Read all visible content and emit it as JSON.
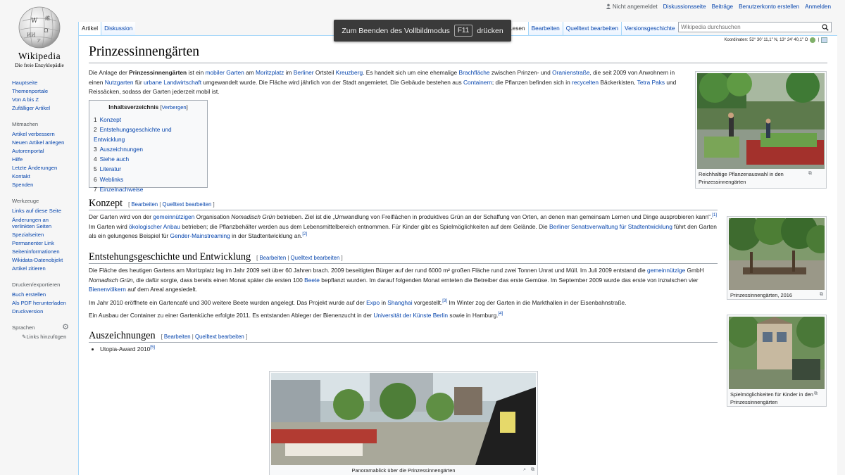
{
  "personal": {
    "notloggedin": "Nicht angemeldet",
    "links": [
      "Diskussionsseite",
      "Beiträge",
      "Benutzerkonto erstellen",
      "Anmelden"
    ]
  },
  "logo": {
    "wordmark": "Wikipedia",
    "tagline": "Die freie Enzyklopädie"
  },
  "sidebar": {
    "nav": [
      "Hauptseite",
      "Themenportale",
      "Von A bis Z",
      "Zufälliger Artikel"
    ],
    "mitmachen_title": "Mitmachen",
    "mitmachen": [
      "Artikel verbessern",
      "Neuen Artikel anlegen",
      "Autorenportal",
      "Hilfe",
      "Letzte Änderungen",
      "Kontakt",
      "Spenden"
    ],
    "werkzeuge_title": "Werkzeuge",
    "werkzeuge": [
      "Links auf diese Seite",
      "Änderungen an verlinkten Seiten",
      "Spezialseiten",
      "Permanenter Link",
      "Seiteninformationen",
      "Wikidata-Datenobjekt",
      "Artikel zitieren"
    ],
    "drucken_title": "Drucken/exportieren",
    "drucken": [
      "Buch erstellen",
      "Als PDF herunterladen",
      "Druckversion"
    ],
    "sprachen_title": "Sprachen",
    "add_links": "Links hinzufügen"
  },
  "tabs": {
    "left": [
      "Artikel",
      "Diskussion"
    ],
    "right": [
      "Lesen",
      "Bearbeiten",
      "Quelltext bearbeiten",
      "Versionsgeschichte"
    ]
  },
  "search": {
    "placeholder": "Wikipedia durchsuchen"
  },
  "fullscreen_notice": {
    "before": "Zum Beenden des Vollbildmodus",
    "key": "F11",
    "after": "drücken"
  },
  "article": {
    "coords": "Koordinaten: 52° 30′ 11,1″ N, 13° 24′ 40,1″ O",
    "title": "Prinzessinnengärten",
    "intro": {
      "t1": "Die Anlage der ",
      "b1": "Prinzessinnengärten",
      "t2": " ist ein ",
      "l1": "mobiler Garten",
      "t3": " am ",
      "l2": "Moritzplatz",
      "t4": " im ",
      "l3": "Berliner",
      "t5": " Ortsteil ",
      "l4": "Kreuzberg",
      "t6": ". Es handelt sich um eine ehemalige ",
      "l5": "Brachfläche",
      "t7": " zwischen Prinzen- und ",
      "l6": "Oranienstraße",
      "t8": ", die seit 2009 von Anwohnern in einen ",
      "l7": "Nutzgarten",
      "t9": " für ",
      "l8": "urbane Landwirtschaft",
      "t10": " umgewandelt wurde. Die Fläche wird jährlich von der Stadt angemietet. Die Gebäude bestehen aus ",
      "l9": "Containern",
      "t11": "; die Pflanzen befinden sich in ",
      "l10": "recycelten",
      "t12": " Bäckerkisten, ",
      "l11": "Tetra Paks",
      "t13": " und Reissäcken, sodass der Garten jederzeit mobil ist."
    },
    "toc": {
      "title": "Inhaltsverzeichnis",
      "toggle": "Verbergen",
      "items": [
        {
          "num": "1",
          "label": "Konzept"
        },
        {
          "num": "2",
          "label": "Entstehungsgeschichte und Entwicklung"
        },
        {
          "num": "3",
          "label": "Auszeichnungen"
        },
        {
          "num": "4",
          "label": "Siehe auch"
        },
        {
          "num": "5",
          "label": "Literatur"
        },
        {
          "num": "6",
          "label": "Weblinks"
        },
        {
          "num": "7",
          "label": "Einzelnachweise"
        }
      ]
    },
    "edit_labels": {
      "bearbeiten": "Bearbeiten",
      "quelltext": "Quelltext bearbeiten"
    },
    "konzept": {
      "heading": "Konzept",
      "t1": "Der Garten wird von der ",
      "l1": "gemeinnützigen",
      "t2": " Organisation ",
      "i1": "Nomadisch Grün",
      "t3": " betrieben. Ziel ist die „Umwandlung von Freiflächen in produktives Grün an der Schaffung von Orten, an denen man gemeinsam Lernen und Dinge ausprobieren kann“.",
      "r1": "[1]",
      "t4": " Im Garten wird ",
      "l2": "ökologischer Anbau",
      "t5": " betrieben; die Pflanzbehälter werden aus dem Lebensmittelbereich entnommen. Für Kinder gibt es Spielmöglichkeiten auf dem Gelände. Die ",
      "l3": "Berliner Senatsverwaltung für Stadtentwicklung",
      "t6": " führt den Garten als ein gelungenes Beispiel für ",
      "l4": "Gender-Mainstreaming",
      "t7": " in der Stadtentwicklung an.",
      "r2": "[2]"
    },
    "entstehung": {
      "heading": "Entstehungsgeschichte und Entwicklung",
      "p1": {
        "t1": "Die Fläche des heutigen Gartens am Moritzplatz lag im Jahr 2009 seit über 60 Jahren brach. 2009 beseitigten Bürger auf der rund 6000 m² großen Fläche rund zwei Tonnen Unrat und Müll. Im Juli 2009 entstand die ",
        "l1": "gemeinnützige",
        "t2": " GmbH ",
        "i1": "Nomadisch Grün",
        "t3": ", die dafür sorgte, dass bereits einen Monat später die ersten 100 ",
        "l2": "Beete",
        "t4": " bepflanzt wurden. Im darauf folgenden Monat ernteten die Betreiber das erste Gemüse. Im September 2009 wurde das erste von inzwischen vier ",
        "l3": "Bienenvölkern",
        "t5": " auf dem Areal angesiedelt."
      },
      "p2": {
        "t1": "Im Jahr 2010 eröffnete ein Gartencafé und 300 weitere Beete wurden angelegt. Das Projekt wurde auf der ",
        "l1": "Expo",
        "t2": " in ",
        "l2": "Shanghai",
        "t3": " vorgestellt.",
        "r1": "[3]",
        "t4": " Im Winter zog der Garten in die Markthallen in der Eisenbahnstraße."
      },
      "p3": {
        "t1": "Ein Ausbau der Container zu einer Gartenküche erfolgte 2011. Es entstanden Ableger der Bienenzucht in der ",
        "l1": "Universität der Künste Berlin",
        "t2": " sowie in Hamburg.",
        "r1": "[4]"
      }
    },
    "auszeichnungen": {
      "heading": "Auszeichnungen",
      "item": "Utopia-Award 2010",
      "ref": "[5]"
    },
    "thumbs": [
      {
        "caption": "Reichhaltige Pflanzenauswahl in den Prinzessinnengärten"
      },
      {
        "caption": "Prinzessinnengärten, 2016"
      },
      {
        "caption": "Spielmöglichkeiten für Kinder in den Prinzessinnengärten"
      },
      {
        "caption": "Panoramablick über die Prinzessinnengärten"
      }
    ]
  }
}
